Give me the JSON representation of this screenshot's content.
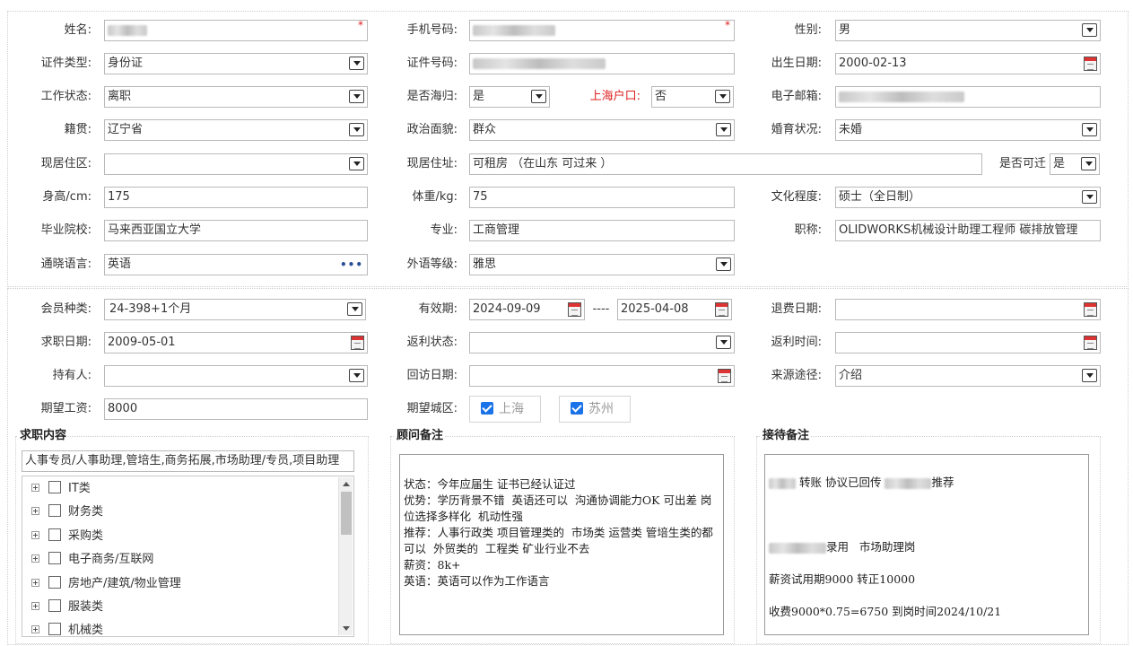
{
  "row1": {
    "name_label": "姓名:",
    "phone_label": "手机号码:",
    "gender_label": "性别:",
    "gender_value": "男",
    "required_mark": "*"
  },
  "row2": {
    "idtype_label": "证件类型:",
    "idtype_value": "身份证",
    "idno_label": "证件号码:",
    "birth_label": "出生日期:",
    "birth_value": "2000-02-13"
  },
  "row3": {
    "workstatus_label": "工作状态:",
    "workstatus_value": "离职",
    "overseas_label": "是否海归:",
    "overseas_value": "是",
    "hukou_label": "上海户口:",
    "hukou_value": "否",
    "email_label": "电子邮箱:"
  },
  "row4": {
    "native_label": "籍贯:",
    "native_value": "辽宁省",
    "political_label": "政治面貌:",
    "political_value": "群众",
    "marital_label": "婚育状况:",
    "marital_value": "未婚"
  },
  "row5": {
    "district_label": "现居住区:",
    "district_value": "",
    "address_label": "现居住址:",
    "address_value": "可租房 （在山东 可过来 ）",
    "relocate_label": "是否可迁",
    "relocate_value": "是"
  },
  "row6": {
    "height_label": "身高/cm:",
    "height_value": "175",
    "weight_label": "体重/kg:",
    "weight_value": "75",
    "education_label": "文化程度:",
    "education_value": "硕士（全日制）"
  },
  "row7": {
    "school_label": "毕业院校:",
    "school_value": "马来西亚国立大学",
    "major_label": "专业:",
    "major_value": "工商管理",
    "title_label": "职称:",
    "title_value": "OLIDWORKS机械设计助理工程师 碳排放管理"
  },
  "row8": {
    "language_label": "通晓语言:",
    "language_value": "英语",
    "language_more": "•••",
    "langlevel_label": "外语等级:",
    "langlevel_value": "雅思"
  },
  "row9": {
    "member_label": "会员种类:",
    "member_value": "24-398+1个月",
    "valid_label": "有效期:",
    "valid_from": "2024-09-09",
    "valid_sep": "----",
    "valid_to": "2025-04-08",
    "refund_label": "退费日期:"
  },
  "row10": {
    "jobdate_label": "求职日期:",
    "jobdate_value": "2009-05-01",
    "rebate_status_label": "返利状态:",
    "rebate_time_label": "返利时间:"
  },
  "row11": {
    "holder_label": "持有人:",
    "visit_label": "回访日期:",
    "source_label": "来源途径:",
    "source_value": "介绍"
  },
  "row12": {
    "salary_label": "期望工资:",
    "salary_value": "8000",
    "city_label": "期望城区:",
    "city_options": [
      "上海",
      "苏州"
    ]
  },
  "job_content": {
    "title": "求职内容",
    "selected": "人事专员/人事助理,管培生,商务拓展,市场助理/专员,项目助理",
    "tree": [
      "IT类",
      "财务类",
      "采购类",
      "电子商务/互联网",
      "房地产/建筑/物业管理",
      "服装类",
      "机械类"
    ],
    "scroll_fraction": 0.33
  },
  "advisor_notes": {
    "title": "顾问备注",
    "text": "\n状态：今年应届生 证书已经认证过\n优势：学历背景不错  英语还可以  沟通协调能力OK 可出差 岗位选择多样化  机动性强\n推荐：人事行政类 项目管理类的  市场类 运营类 管培生类的都可以  外贸类的  工程类 矿业行业不去\n薪资：8k+\n英语：英语可以作为工作语言"
  },
  "reception_notes": {
    "title": "接待备注",
    "line1_a": "转账 协议已回传",
    "line1_b": "推荐",
    "line2": "录用   市场助理岗",
    "line3": "薪资试用期9000 转正10000",
    "line4": "收费9000*0.75=6750 到岗时间2024/10/21"
  }
}
